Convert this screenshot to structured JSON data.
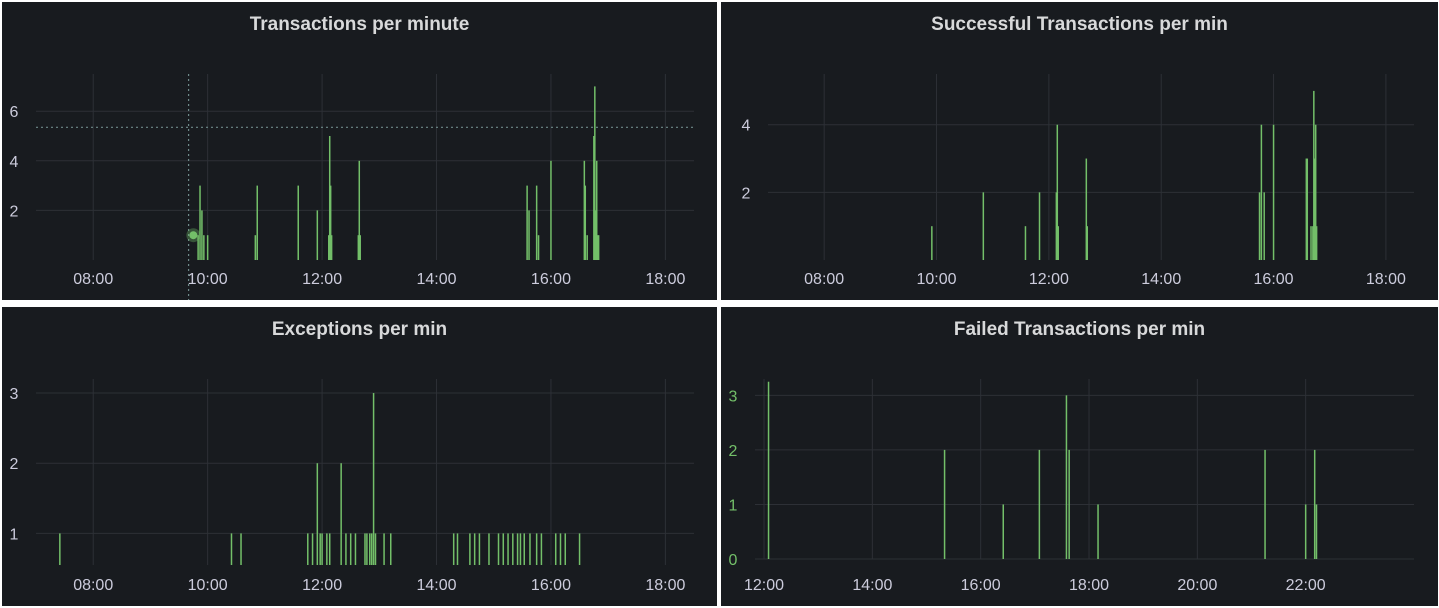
{
  "colors": {
    "series": "#73bf69",
    "grid": "#2d3036",
    "text": "#ccccdc",
    "crosshair": "#6e8a8a"
  },
  "panels": [
    {
      "title": "Transactions per minute",
      "chart_data": {
        "type": "bar",
        "title": "Transactions per minute",
        "x_ticks": [
          "08:00",
          "10:00",
          "12:00",
          "14:00",
          "16:00",
          "18:00"
        ],
        "y_ticks": [
          2,
          4,
          6
        ],
        "xlim": [
          "07:00",
          "18:30"
        ],
        "ylim": [
          0,
          7.5
        ],
        "grid": true,
        "crosshair": {
          "x": "09:40",
          "y": 5.35
        },
        "hover_point": {
          "x": "09:45",
          "y": 1
        },
        "x": [
          "09:50",
          "09:52",
          "09:54",
          "09:56",
          "10:00",
          "10:50",
          "10:52",
          "11:35",
          "11:55",
          "12:07",
          "12:08",
          "12:09",
          "12:10",
          "12:38",
          "12:39",
          "12:40",
          "15:35",
          "15:37",
          "15:45",
          "15:47",
          "16:00",
          "16:35",
          "16:36",
          "16:38",
          "16:45",
          "16:46",
          "16:47",
          "16:48",
          "16:49",
          "16:50"
        ],
        "values": [
          1,
          3,
          2,
          1,
          1,
          1,
          3,
          3,
          2,
          1,
          5,
          3,
          1,
          1,
          4,
          1,
          3,
          2,
          3,
          1,
          4,
          4,
          3,
          1,
          5,
          7,
          2,
          4,
          1,
          1
        ]
      }
    },
    {
      "title": "Successful Transactions per min",
      "chart_data": {
        "type": "bar",
        "title": "Successful Transactions per min",
        "x_ticks": [
          "08:00",
          "10:00",
          "12:00",
          "14:00",
          "16:00",
          "18:00"
        ],
        "y_ticks": [
          2,
          4
        ],
        "xlim": [
          "07:00",
          "18:30"
        ],
        "ylim": [
          0,
          5.5
        ],
        "grid": true,
        "x": [
          "09:55",
          "10:50",
          "11:35",
          "11:50",
          "12:08",
          "12:09",
          "12:10",
          "12:40",
          "12:41",
          "15:45",
          "15:47",
          "15:50",
          "16:00",
          "16:35",
          "16:36",
          "16:40",
          "16:42",
          "16:43",
          "16:44",
          "16:45",
          "16:46"
        ],
        "values": [
          1,
          2,
          1,
          2,
          2,
          4,
          1,
          3,
          1,
          2,
          4,
          2,
          4,
          3,
          3,
          1,
          1,
          5,
          3,
          4,
          1
        ]
      }
    },
    {
      "title": "Exceptions per min",
      "chart_data": {
        "type": "bar",
        "title": "Exceptions per min",
        "x_ticks": [
          "08:00",
          "10:00",
          "12:00",
          "14:00",
          "16:00",
          "18:00"
        ],
        "y_ticks": [
          1,
          2,
          3
        ],
        "xlim": [
          "07:00",
          "18:30"
        ],
        "ylim": [
          0.55,
          3.2
        ],
        "grid": true,
        "x": [
          "07:25",
          "10:25",
          "10:35",
          "11:45",
          "11:50",
          "11:55",
          "11:58",
          "12:00",
          "12:05",
          "12:08",
          "12:20",
          "12:25",
          "12:30",
          "12:35",
          "12:45",
          "12:47",
          "12:50",
          "12:52",
          "12:54",
          "12:56",
          "13:05",
          "13:12",
          "14:18",
          "14:22",
          "14:35",
          "14:40",
          "14:45",
          "14:55",
          "15:05",
          "15:10",
          "15:15",
          "15:20",
          "15:25",
          "15:28",
          "15:32",
          "15:38",
          "15:45",
          "15:50",
          "16:05",
          "16:10",
          "16:15",
          "16:30"
        ],
        "values": [
          1,
          1,
          1,
          1,
          1,
          2,
          1,
          1,
          1,
          1,
          2,
          1,
          1,
          1,
          1,
          1,
          1,
          1,
          3,
          1,
          1,
          1,
          1,
          1,
          1,
          1,
          1,
          1,
          1,
          1,
          1,
          1,
          1,
          1,
          1,
          1,
          1,
          1,
          1,
          1,
          1,
          1
        ]
      }
    },
    {
      "title": "Failed Transactions per min",
      "chart_data": {
        "type": "bar",
        "title": "Failed Transactions per min",
        "x_ticks": [
          "12:00",
          "14:00",
          "16:00",
          "18:00",
          "20:00",
          "22:00"
        ],
        "y_ticks": [
          0,
          1,
          2,
          3
        ],
        "xlim": [
          "11:50",
          "24:00"
        ],
        "ylim": [
          0,
          3.3
        ],
        "grid": true,
        "x": [
          "12:05",
          "15:20",
          "16:25",
          "17:05",
          "17:35",
          "17:38",
          "18:10",
          "21:15",
          "22:00",
          "22:10",
          "22:12"
        ],
        "values": [
          3.25,
          2,
          1,
          2,
          3,
          2,
          1,
          2,
          1,
          2,
          1
        ]
      }
    }
  ]
}
